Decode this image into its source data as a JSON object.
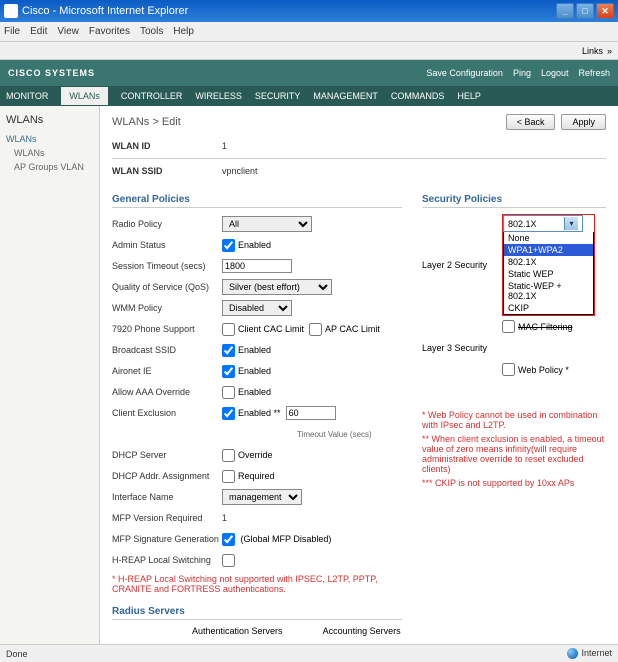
{
  "window": {
    "title": "Cisco - Microsoft Internet Explorer"
  },
  "menubar": [
    "File",
    "Edit",
    "View",
    "Favorites",
    "Tools",
    "Help"
  ],
  "linksbar": {
    "label": "Links",
    "chevron": "»"
  },
  "banner": {
    "logo": "CISCO SYSTEMS",
    "links": [
      "Save Configuration",
      "Ping",
      "Logout",
      "Refresh"
    ]
  },
  "nav": [
    "MONITOR",
    "WLANs",
    "CONTROLLER",
    "WIRELESS",
    "SECURITY",
    "MANAGEMENT",
    "COMMANDS",
    "HELP"
  ],
  "nav_active": "WLANs",
  "sidebar": {
    "title": "WLANs",
    "items": [
      "WLANs",
      "WLANs",
      "AP Groups VLAN"
    ]
  },
  "breadcrumb": "WLANs > Edit",
  "buttons": {
    "back": "< Back",
    "apply": "Apply"
  },
  "wlan_id": {
    "label": "WLAN ID",
    "value": "1"
  },
  "wlan_ssid": {
    "label": "WLAN SSID",
    "value": "vpnclient"
  },
  "sections": {
    "general": "General Policies",
    "security": "Security Policies",
    "radius": "Radius Servers"
  },
  "general": {
    "radio_policy": {
      "label": "Radio Policy",
      "value": "All"
    },
    "admin_status": {
      "label": "Admin Status",
      "text": "Enabled",
      "checked": true
    },
    "session_timeout": {
      "label": "Session Timeout (secs)",
      "value": "1800"
    },
    "qos": {
      "label": "Quality of Service (QoS)",
      "value": "Silver (best effort)"
    },
    "wmm": {
      "label": "WMM Policy",
      "value": "Disabled"
    },
    "phone": {
      "label": "7920 Phone Support",
      "cac1": "Client CAC Limit",
      "cac2": "AP CAC Limit"
    },
    "broadcast": {
      "label": "Broadcast SSID",
      "text": "Enabled",
      "checked": true
    },
    "aironet": {
      "label": "Aironet IE",
      "text": "Enabled",
      "checked": true
    },
    "aaa": {
      "label": "Allow AAA Override",
      "text": "Enabled",
      "checked": false
    },
    "exclusion": {
      "label": "Client Exclusion",
      "text": "Enabled **",
      "checked": true,
      "value": "60",
      "hint": "Timeout Value (secs)"
    },
    "dhcp_srv": {
      "label": "DHCP Server",
      "text": "Override",
      "checked": false
    },
    "dhcp_addr": {
      "label": "DHCP Addr. Assignment",
      "text": "Required",
      "checked": false
    },
    "interface": {
      "label": "Interface Name",
      "value": "management"
    },
    "mfp_ver": {
      "label": "MFP Version Required",
      "value": "1"
    },
    "mfp_sig": {
      "label": "MFP Signature Generation",
      "text": "(Global MFP Disabled)",
      "checked": true
    },
    "hreap": {
      "label": "H-REAP Local Switching",
      "checked": false
    },
    "hreap_note": "* H-REAP Local Switching not supported with IPSEC, L2TP, PPTP, CRANITE and FORTRESS authentications."
  },
  "security": {
    "l2_label": "Layer 2 Security",
    "l2_value": "802.1X",
    "l2_options": [
      "None",
      "WPA1+WPA2",
      "802.1X",
      "Static WEP",
      "Static-WEP + 802.1X",
      "CKIP"
    ],
    "l2_highlight": "WPA1+WPA2",
    "mac_filter": "MAC Filtering",
    "l3_label": "Layer 3 Security",
    "web_policy": "Web Policy *",
    "notes": [
      "* Web Policy cannot be used in combination with IPsec and L2TP.",
      "** When client exclusion is enabled, a timeout value of zero means infinity(will require administrative override to reset excluded clients)",
      "*** CKIP is not supported by 10xx APs"
    ]
  },
  "radius": {
    "auth": "Authentication Servers",
    "acct": "Accounting Servers"
  },
  "status": {
    "done": "Done",
    "zone": "Internet"
  }
}
